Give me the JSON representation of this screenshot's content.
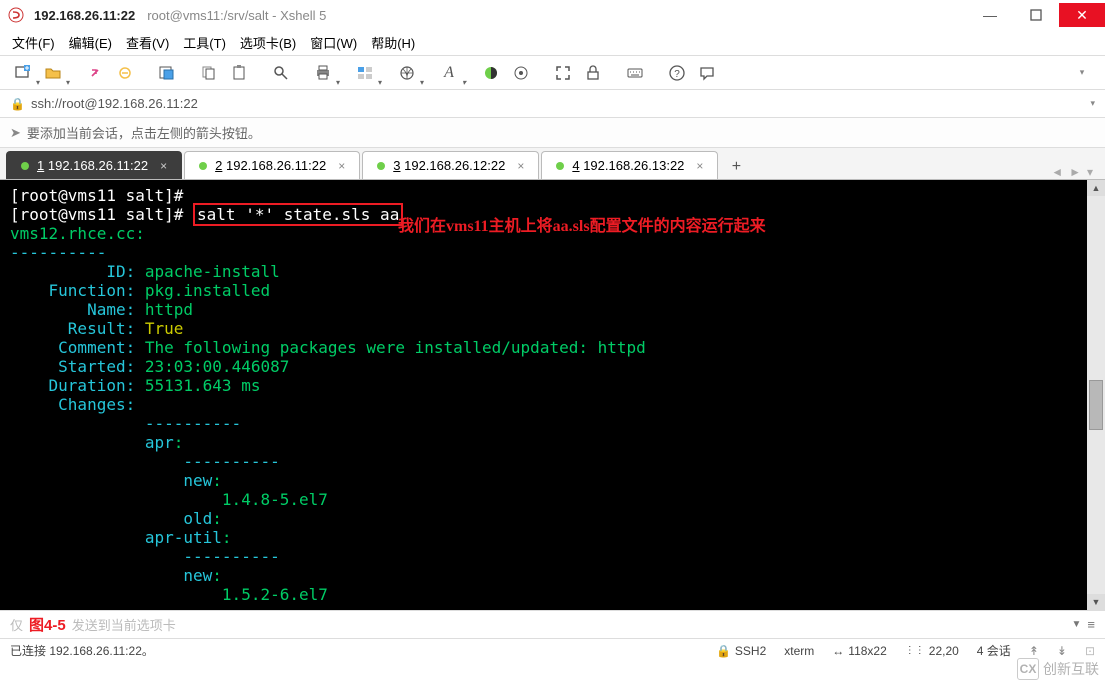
{
  "title": {
    "main": "192.168.26.11:22",
    "sub": "root@vms11:/srv/salt - Xshell 5"
  },
  "menu": [
    "文件(F)",
    "编辑(E)",
    "查看(V)",
    "工具(T)",
    "选项卡(B)",
    "窗口(W)",
    "帮助(H)"
  ],
  "addressbar": "ssh://root@192.168.26.11:22",
  "hint": "要添加当前会话，点击左侧的箭头按钮。",
  "tabs": [
    {
      "num": "1",
      "label": "192.168.26.11:22",
      "active": true
    },
    {
      "num": "2",
      "label": "192.168.26.11:22",
      "active": false
    },
    {
      "num": "3",
      "label": "192.168.26.12:22",
      "active": false
    },
    {
      "num": "4",
      "label": "192.168.26.13:22",
      "active": false
    }
  ],
  "terminal": {
    "prompt1": "[root@vms11 salt]# ",
    "prompt2": "[root@vms11 salt]# ",
    "cmd": "salt '*' state.sls aa",
    "annotation": "我们在vms11主机上将aa.sls配置文件的内容运行起来",
    "host": "vms12.rhce.cc:",
    "dashes": "----------",
    "fields": {
      "id_label": "          ID:",
      "id_val": " apache-install",
      "fn_label": "    Function:",
      "fn_val": " pkg.installed",
      "nm_label": "        Name:",
      "nm_val": " httpd",
      "rs_label": "      Result:",
      "rs_val": " True",
      "cm_label": "     Comment:",
      "cm_val": " The following packages were installed/updated: httpd",
      "st_label": "     Started:",
      "st_val": " 23:03:00.446087",
      "du_label": "    Duration:",
      "du_val": " 55131.643 ms",
      "ch_label": "     Changes:"
    },
    "changes": {
      "dashes_indent": "              ----------",
      "apr": "              apr",
      "dashes2": "                  ----------",
      "new1": "                  new",
      "val1": "                      1.4.8-5.el7",
      "old1": "                  old",
      "apr_util": "              apr-util",
      "new2": "                  new",
      "val2": "                      1.5.2-6.el7"
    }
  },
  "figure_caption": "图4-5",
  "input_placeholder": "发送到当前选项卡",
  "status": {
    "conn": "已连接 192.168.26.11:22。",
    "ssh": "SSH2",
    "term": "xterm",
    "size": "118x22",
    "pos": "22,20",
    "sess": "4 会话"
  },
  "watermark": "创新互联"
}
